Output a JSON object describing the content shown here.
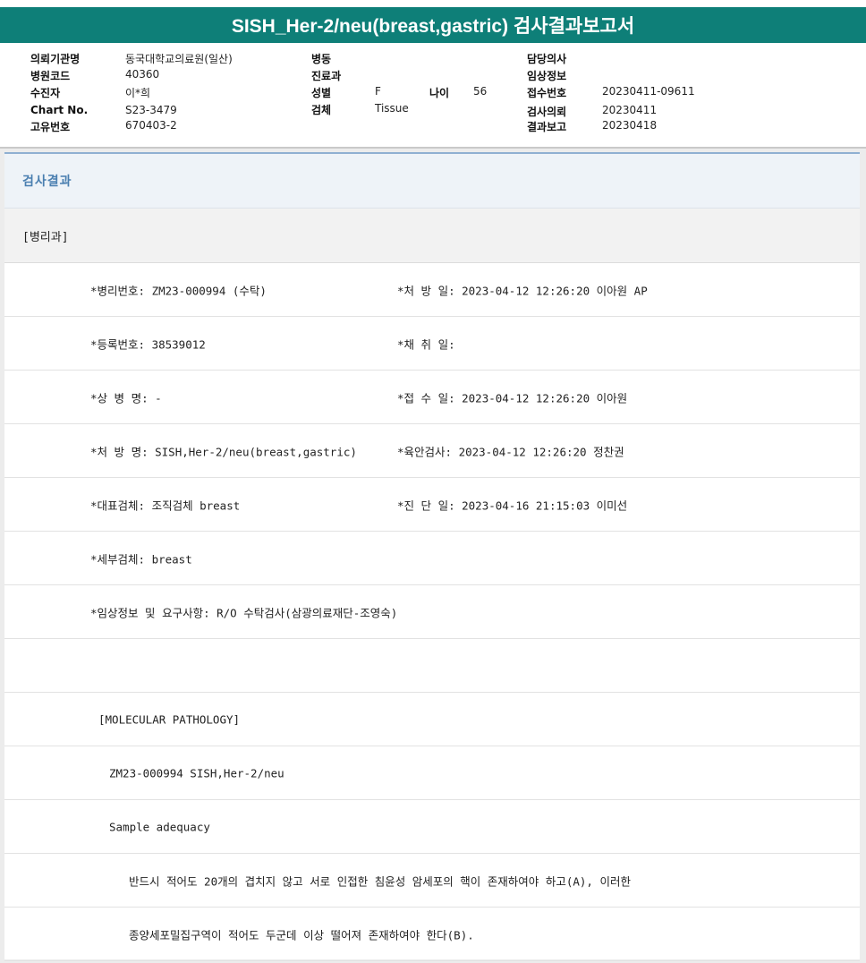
{
  "title": "SISH_Her-2/neu(breast,gastric) 검사결과보고서",
  "header": {
    "col1": [
      {
        "label": "의뢰기관명",
        "value": "동국대학교의료원(일산)"
      },
      {
        "label": "병원코드",
        "value": "40360"
      },
      {
        "label": "수진자",
        "value": "이*희"
      },
      {
        "label": "Chart No.",
        "value": "S23-3479"
      },
      {
        "label": "고유번호",
        "value": "670403-2"
      }
    ],
    "col2": [
      {
        "label": "병동",
        "value": ""
      },
      {
        "label": "진료과",
        "value": ""
      },
      {
        "label": "성별",
        "value": "F"
      },
      {
        "label": "검체",
        "value": "Tissue"
      }
    ],
    "age": {
      "label": "나이",
      "value": "56"
    },
    "col3": [
      {
        "label": "담당의사",
        "value": ""
      },
      {
        "label": "임상정보",
        "value": ""
      },
      {
        "label": "접수번호",
        "value": "20230411-09611"
      },
      {
        "label": "검사의뢰",
        "value": "20230411"
      },
      {
        "label": "결과보고",
        "value": "20230418"
      }
    ]
  },
  "section_title": "검사결과",
  "department": "[병리과]",
  "rows": [
    {
      "left": "*병리번호: ZM23-000994 (수탁)",
      "right": "*처 방 일: 2023-04-12 12:26:20  이아원 AP"
    },
    {
      "left": "*등록번호: 38539012",
      "right": "*채 취 일:"
    },
    {
      "left": "*상 병 명: -",
      "right": "*접 수 일: 2023-04-12 12:26:20  이아원"
    },
    {
      "left": "*처 방 명: SISH,Her-2/neu(breast,gastric)",
      "right": "*육안검사: 2023-04-12 12:26:20  정찬권"
    },
    {
      "left": "*대표검체: 조직검체 breast",
      "right": "*진 단 일: 2023-04-16 21:15:03  이미선"
    },
    {
      "left": "*세부검체: breast",
      "right": ""
    },
    {
      "left": "*임상정보 및 요구사항: R/O 수탁검사(삼광의료재단-조영숙)",
      "right": ""
    }
  ],
  "body_lines": [
    "",
    "[MOLECULAR PATHOLOGY]",
    "ZM23-000994     SISH,Her-2/neu",
    "Sample adequacy",
    "반드시 적어도 20개의 겹치지 않고 서로 인접한 침윤성 암세포의 핵이 존재하여야 하고(A), 이러한",
    "종양세포밀집구역이 적어도 두군데 이상 떨어져 존재하여야 한다(B)."
  ]
}
